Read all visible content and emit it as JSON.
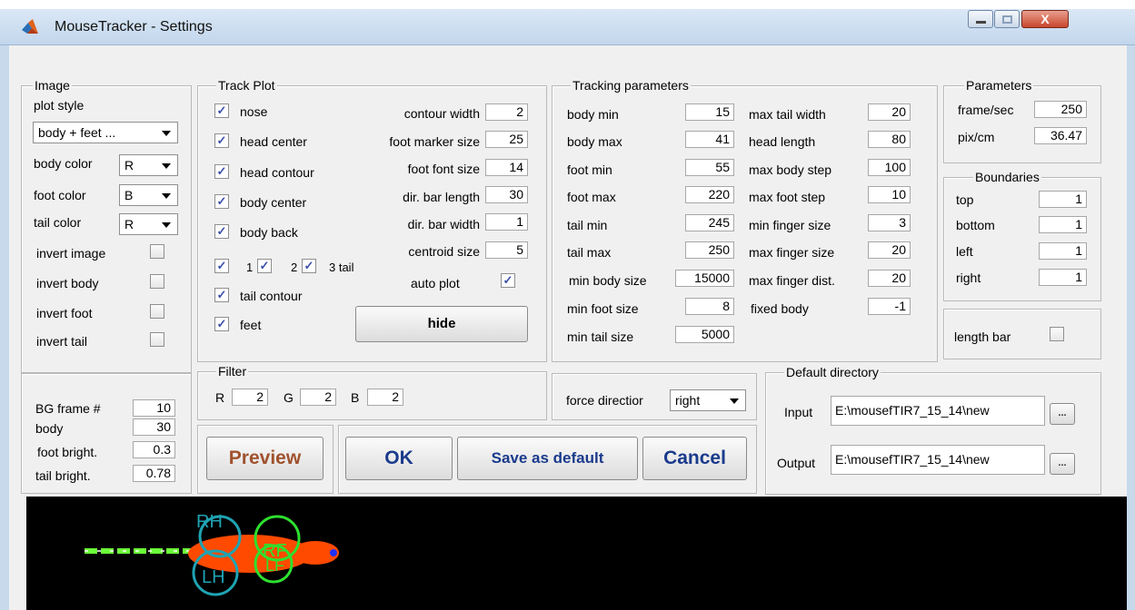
{
  "window": {
    "title": "MouseTracker - Settings",
    "minimize_label": "▬",
    "maximize_label": "□",
    "close_label": "X"
  },
  "image": {
    "group_title": "Image",
    "plot_style_label": "plot style",
    "plot_style_value": "body + feet ...",
    "body_color_label": "body color",
    "body_color_value": "R",
    "foot_color_label": "foot color",
    "foot_color_value": "B",
    "tail_color_label": "tail  color",
    "tail_color_value": "R",
    "invert_image_label": "invert image",
    "invert_body_label": "invert body",
    "invert_foot_label": "invert foot",
    "invert_tail_label": "invert tail",
    "bg_frame_label": "BG frame #",
    "bg_frame_value": "10",
    "body_label": "body",
    "body_value": "30",
    "foot_bright_label": "foot bright.",
    "foot_bright_value": "0.3",
    "tail_bright_label": "tail bright.",
    "tail_bright_value": "0.78"
  },
  "track_plot": {
    "group_title": "Track Plot",
    "checks": [
      "nose",
      "head center",
      "head contour",
      "body center",
      "body back"
    ],
    "tail_checks": [
      "1",
      "2",
      "3 tail"
    ],
    "tail_contour_label": "tail contour",
    "feet_label": "feet",
    "params": [
      {
        "label": "contour width",
        "value": "2"
      },
      {
        "label": "foot marker size",
        "value": "25"
      },
      {
        "label": "foot font size",
        "value": "14"
      },
      {
        "label": "dir. bar length",
        "value": "30"
      },
      {
        "label": "dir. bar width",
        "value": "1"
      },
      {
        "label": "centroid size",
        "value": "5"
      }
    ],
    "auto_plot_label": "auto plot",
    "hide_label": "hide"
  },
  "tracking": {
    "group_title": "Tracking parameters",
    "left": [
      {
        "label": "body min",
        "value": "15"
      },
      {
        "label": "body max",
        "value": "41"
      },
      {
        "label": "foot min",
        "value": "55"
      },
      {
        "label": "foot max",
        "value": "220"
      },
      {
        "label": "tail min",
        "value": "245"
      },
      {
        "label": "tail max",
        "value": "250"
      },
      {
        "label": "min body size",
        "value": "15000"
      },
      {
        "label": "min foot size",
        "value": "8"
      },
      {
        "label": "min tail size",
        "value": "5000"
      }
    ],
    "right": [
      {
        "label": "max tail width",
        "value": "20"
      },
      {
        "label": "head length",
        "value": "80"
      },
      {
        "label": "max body step",
        "value": "100"
      },
      {
        "label": "max foot step",
        "value": "10"
      },
      {
        "label": "min finger size",
        "value": "3"
      },
      {
        "label": "max finger size",
        "value": "20"
      },
      {
        "label": "max finger dist.",
        "value": "20"
      },
      {
        "label": "fixed body",
        "value": "-1"
      }
    ]
  },
  "parameters": {
    "group_title": "Parameters",
    "frame_sec_label": "frame/sec",
    "frame_sec_value": "250",
    "pix_cm_label": "pix/cm",
    "pix_cm_value": "36.47"
  },
  "boundaries": {
    "group_title": "Boundaries",
    "items": [
      {
        "label": "top",
        "value": "1"
      },
      {
        "label": "bottom",
        "value": "1"
      },
      {
        "label": "left",
        "value": "1"
      },
      {
        "label": "right",
        "value": "1"
      }
    ]
  },
  "length_bar_label": "length bar",
  "filter": {
    "group_title": "Filter",
    "r_label": "R",
    "r_value": "2",
    "g_label": "G",
    "g_value": "2",
    "b_label": "B",
    "b_value": "2"
  },
  "force_direction": {
    "label": "force directior",
    "value": "right"
  },
  "default_directory": {
    "group_title": "Default directory",
    "input_label": "Input",
    "input_value": "E:\\mousefTIR7_15_14\\new",
    "output_label": "Output",
    "output_value": "E:\\mousefTIR7_15_14\\new",
    "browse_label": "..."
  },
  "buttons": {
    "preview": "Preview",
    "ok": "OK",
    "save_default": "Save as default",
    "cancel": "Cancel"
  },
  "preview_canvas": {
    "marker_labels": [
      "RH",
      "LH",
      "RF",
      "LF"
    ]
  },
  "colors": {
    "accent_blue": "#1a3a8c",
    "preview_brown": "#a0522d",
    "mouse_body": "#ff4a00",
    "marker_cyan": "#1fa3b3",
    "marker_green": "#2ee02e",
    "tail_green": "#6cff3a"
  }
}
